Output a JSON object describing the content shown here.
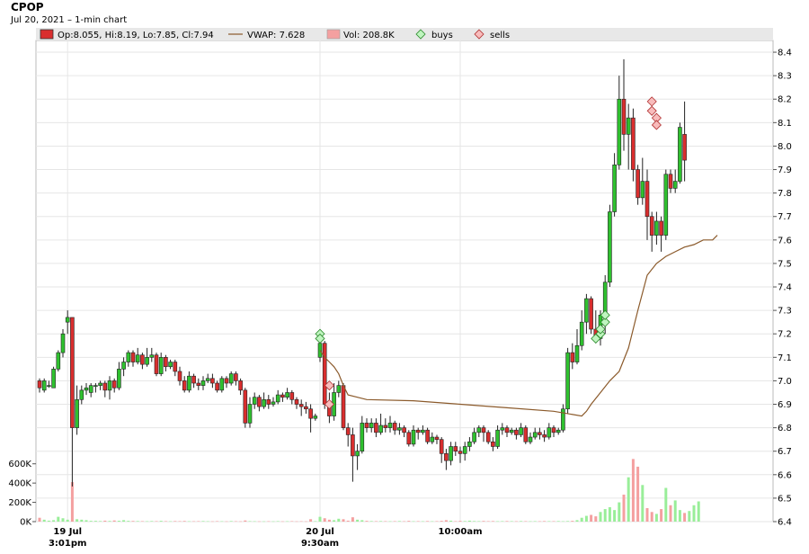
{
  "header": {
    "ticker": "CPOP",
    "subtitle": "Jul 20, 2021  – 1-min chart"
  },
  "legend": {
    "ohlc": "Op:8.055, Hi:8.19, Lo:7.85, Cl:7.94",
    "vwap": "VWAP: 7.628",
    "volume": "Vol: 208.8K",
    "buys": "buys",
    "sells": "sells"
  },
  "colors": {
    "up_candle": "#2fc12f",
    "down_candle": "#d92e2e",
    "up_volume": "#99ee99",
    "down_volume": "#f4a0a0",
    "vwap_line": "#8b5a2b",
    "buy_marker": "#bff5bf",
    "sell_marker": "#f8bcbc",
    "grid": "#e6e6e6",
    "legend_bg": "#e8e8e8"
  },
  "chart_data": {
    "type": "candlestick",
    "y_axis": {
      "min": 6.4,
      "max": 8.45,
      "ticks": [
        "6.4",
        "6.5",
        "6.6",
        "6.7",
        "6.8",
        "6.9",
        "7.0",
        "7.1",
        "7.2",
        "7.3",
        "7.4",
        "7.5",
        "7.6",
        "7.7",
        "7.8",
        "7.9",
        "8.0",
        "8.1",
        "8.2",
        "8.3",
        "8.4"
      ]
    },
    "volume_axis": {
      "min": 0,
      "max": 700000,
      "ticks": [
        {
          "v": 0,
          "label": "0K"
        },
        {
          "v": 200000,
          "label": "200K"
        },
        {
          "v": 400000,
          "label": "400K"
        },
        {
          "v": 600000,
          "label": "600K"
        }
      ]
    },
    "x_labels": [
      {
        "index": 6,
        "line1": "19 Jul",
        "line2": "3:01pm"
      },
      {
        "index": 60,
        "line1": "20 Jul",
        "line2": "9:30am"
      },
      {
        "index": 90,
        "line1": "10:00am",
        "line2": ""
      }
    ],
    "grid": true,
    "candles": [
      [
        7.0,
        6.97,
        7.01,
        6.95
      ],
      [
        6.96,
        7.0,
        7.01,
        6.95
      ],
      [
        6.98,
        6.98,
        7.0,
        6.97
      ],
      [
        6.97,
        7.05,
        7.06,
        6.97
      ],
      [
        7.05,
        7.12,
        7.13,
        7.04
      ],
      [
        7.12,
        7.2,
        7.22,
        7.1
      ],
      [
        7.25,
        7.27,
        7.3,
        7.2
      ],
      [
        7.27,
        6.8,
        7.27,
        6.55
      ],
      [
        6.8,
        6.92,
        6.98,
        6.77
      ],
      [
        6.92,
        6.96,
        6.98,
        6.9
      ],
      [
        6.96,
        6.97,
        6.99,
        6.94
      ],
      [
        6.95,
        6.98,
        6.99,
        6.93
      ],
      [
        6.98,
        6.98,
        6.99,
        6.95
      ],
      [
        6.98,
        6.99,
        7.0,
        6.96
      ],
      [
        6.99,
        6.96,
        7.0,
        6.93
      ],
      [
        6.96,
        7.0,
        7.02,
        6.92
      ],
      [
        7.0,
        6.97,
        7.01,
        6.95
      ],
      [
        6.97,
        7.05,
        7.08,
        6.96
      ],
      [
        7.05,
        7.08,
        7.1,
        7.02
      ],
      [
        7.08,
        7.12,
        7.13,
        7.06
      ],
      [
        7.12,
        7.08,
        7.13,
        7.06
      ],
      [
        7.08,
        7.11,
        7.14,
        7.07
      ],
      [
        7.11,
        7.07,
        7.12,
        7.05
      ],
      [
        7.07,
        7.1,
        7.14,
        7.06
      ],
      [
        7.1,
        7.11,
        7.14,
        7.08
      ],
      [
        7.11,
        7.03,
        7.12,
        7.02
      ],
      [
        7.03,
        7.1,
        7.12,
        7.02
      ],
      [
        7.1,
        7.06,
        7.11,
        7.04
      ],
      [
        7.06,
        7.08,
        7.09,
        7.05
      ],
      [
        7.08,
        7.04,
        7.09,
        7.02
      ],
      [
        7.04,
        7.0,
        7.06,
        6.98
      ],
      [
        7.0,
        6.96,
        7.02,
        6.95
      ],
      [
        6.96,
        7.02,
        7.04,
        6.95
      ],
      [
        7.02,
        6.99,
        7.03,
        6.97
      ],
      [
        6.99,
        6.98,
        7.01,
        6.96
      ],
      [
        6.98,
        7.0,
        7.02,
        6.96
      ],
      [
        7.0,
        7.01,
        7.03,
        6.99
      ],
      [
        7.01,
        6.99,
        7.03,
        6.97
      ],
      [
        6.99,
        6.96,
        7.0,
        6.95
      ],
      [
        6.96,
        7.01,
        7.02,
        6.95
      ],
      [
        7.01,
        6.99,
        7.02,
        6.97
      ],
      [
        6.99,
        7.03,
        7.04,
        6.98
      ],
      [
        7.03,
        7.0,
        7.04,
        6.98
      ],
      [
        7.0,
        6.96,
        7.01,
        6.94
      ],
      [
        6.96,
        6.82,
        6.97,
        6.8
      ],
      [
        6.82,
        6.9,
        6.93,
        6.8
      ],
      [
        6.9,
        6.93,
        6.95,
        6.88
      ],
      [
        6.93,
        6.89,
        6.94,
        6.87
      ],
      [
        6.89,
        6.92,
        6.95,
        6.88
      ],
      [
        6.92,
        6.9,
        6.94,
        6.88
      ],
      [
        6.9,
        6.91,
        6.93,
        6.89
      ],
      [
        6.91,
        6.94,
        6.96,
        6.9
      ],
      [
        6.94,
        6.93,
        6.95,
        6.91
      ],
      [
        6.93,
        6.95,
        6.97,
        6.92
      ],
      [
        6.95,
        6.92,
        6.96,
        6.9
      ],
      [
        6.92,
        6.9,
        6.93,
        6.88
      ],
      [
        6.9,
        6.89,
        6.92,
        6.85
      ],
      [
        6.89,
        6.88,
        6.91,
        6.86
      ],
      [
        6.88,
        6.84,
        6.9,
        6.78
      ],
      [
        6.84,
        6.85,
        6.86,
        6.83
      ],
      [
        7.1,
        7.16,
        7.18,
        7.08
      ],
      [
        7.16,
        6.9,
        7.17,
        6.88
      ],
      [
        6.9,
        6.85,
        6.95,
        6.82
      ],
      [
        6.85,
        6.95,
        6.99,
        6.83
      ],
      [
        6.95,
        6.98,
        7.0,
        6.93
      ],
      [
        6.98,
        6.8,
        6.99,
        6.79
      ],
      [
        6.8,
        6.77,
        6.82,
        6.72
      ],
      [
        6.77,
        6.68,
        6.8,
        6.57
      ],
      [
        6.68,
        6.7,
        6.73,
        6.62
      ],
      [
        6.7,
        6.82,
        6.85,
        6.69
      ],
      [
        6.82,
        6.8,
        6.84,
        6.78
      ],
      [
        6.8,
        6.82,
        6.84,
        6.78
      ],
      [
        6.82,
        6.78,
        6.84,
        6.76
      ],
      [
        6.78,
        6.81,
        6.86,
        6.77
      ],
      [
        6.81,
        6.8,
        6.84,
        6.78
      ],
      [
        6.8,
        6.82,
        6.85,
        6.78
      ],
      [
        6.82,
        6.79,
        6.83,
        6.77
      ],
      [
        6.79,
        6.8,
        6.82,
        6.77
      ],
      [
        6.8,
        6.78,
        6.81,
        6.76
      ],
      [
        6.78,
        6.73,
        6.79,
        6.72
      ],
      [
        6.73,
        6.79,
        6.81,
        6.72
      ],
      [
        6.79,
        6.78,
        6.8,
        6.75
      ],
      [
        6.78,
        6.79,
        6.81,
        6.77
      ],
      [
        6.79,
        6.74,
        6.8,
        6.73
      ],
      [
        6.74,
        6.76,
        6.78,
        6.73
      ],
      [
        6.76,
        6.75,
        6.77,
        6.73
      ],
      [
        6.75,
        6.69,
        6.76,
        6.65
      ],
      [
        6.69,
        6.66,
        6.71,
        6.62
      ],
      [
        6.66,
        6.72,
        6.74,
        6.64
      ],
      [
        6.72,
        6.7,
        6.74,
        6.68
      ],
      [
        6.7,
        6.69,
        6.72,
        6.65
      ],
      [
        6.69,
        6.72,
        6.74,
        6.66
      ],
      [
        6.72,
        6.74,
        6.76,
        6.7
      ],
      [
        6.74,
        6.78,
        6.8,
        6.73
      ],
      [
        6.78,
        6.8,
        6.81,
        6.76
      ],
      [
        6.8,
        6.78,
        6.81,
        6.74
      ],
      [
        6.78,
        6.74,
        6.79,
        6.73
      ],
      [
        6.74,
        6.72,
        6.76,
        6.7
      ],
      [
        6.72,
        6.79,
        6.81,
        6.71
      ],
      [
        6.79,
        6.8,
        6.82,
        6.77
      ],
      [
        6.8,
        6.78,
        6.81,
        6.76
      ],
      [
        6.78,
        6.79,
        6.8,
        6.77
      ],
      [
        6.79,
        6.77,
        6.8,
        6.75
      ],
      [
        6.77,
        6.8,
        6.82,
        6.76
      ],
      [
        6.8,
        6.74,
        6.81,
        6.73
      ],
      [
        6.74,
        6.76,
        6.78,
        6.73
      ],
      [
        6.76,
        6.78,
        6.8,
        6.75
      ],
      [
        6.78,
        6.77,
        6.8,
        6.75
      ],
      [
        6.77,
        6.76,
        6.79,
        6.74
      ],
      [
        6.76,
        6.8,
        6.82,
        6.75
      ],
      [
        6.8,
        6.78,
        6.81,
        6.76
      ],
      [
        6.78,
        6.79,
        6.8,
        6.77
      ],
      [
        6.79,
        6.88,
        6.9,
        6.78
      ],
      [
        6.88,
        7.12,
        7.14,
        6.86
      ],
      [
        7.12,
        7.08,
        7.16,
        7.05
      ],
      [
        7.08,
        7.15,
        7.22,
        7.07
      ],
      [
        7.15,
        7.25,
        7.3,
        7.13
      ],
      [
        7.25,
        7.35,
        7.37,
        7.2
      ],
      [
        7.35,
        7.22,
        7.36,
        7.2
      ],
      [
        7.22,
        7.18,
        7.3,
        7.16
      ],
      [
        7.18,
        7.28,
        7.3,
        7.15
      ],
      [
        7.28,
        7.42,
        7.45,
        7.2
      ],
      [
        7.42,
        7.72,
        7.75,
        7.4
      ],
      [
        7.72,
        7.92,
        7.97,
        7.7
      ],
      [
        7.92,
        8.2,
        8.3,
        7.9
      ],
      [
        8.2,
        8.05,
        8.37,
        7.98
      ],
      [
        8.05,
        8.12,
        8.18,
        7.9
      ],
      [
        8.12,
        7.9,
        8.16,
        7.85
      ],
      [
        7.9,
        7.78,
        7.92,
        7.75
      ],
      [
        7.78,
        7.85,
        7.95,
        7.75
      ],
      [
        7.85,
        7.7,
        7.9,
        7.6
      ],
      [
        7.7,
        7.62,
        7.72,
        7.55
      ],
      [
        7.62,
        7.68,
        7.72,
        7.58
      ],
      [
        7.68,
        7.62,
        7.7,
        7.55
      ],
      [
        7.62,
        7.88,
        7.9,
        7.6
      ],
      [
        7.88,
        7.82,
        7.9,
        7.8
      ],
      [
        7.82,
        7.85,
        7.9,
        7.8
      ],
      [
        7.85,
        8.08,
        8.1,
        7.84
      ],
      [
        8.05,
        7.94,
        8.19,
        7.85
      ]
    ],
    "volume": [
      40000,
      20000,
      10000,
      15000,
      50000,
      35000,
      20000,
      410000,
      25000,
      20000,
      15000,
      8000,
      8000,
      6000,
      10000,
      7000,
      12000,
      9000,
      15000,
      8000,
      7000,
      6000,
      5000,
      4000,
      6000,
      5000,
      8000,
      5000,
      4000,
      6000,
      5000,
      7000,
      4000,
      4000,
      5000,
      6000,
      4000,
      3000,
      5000,
      4000,
      3000,
      6000,
      4000,
      3000,
      12000,
      5000,
      4000,
      3000,
      3000,
      4000,
      3000,
      5000,
      3000,
      4000,
      5000,
      3000,
      4000,
      3000,
      25000,
      5000,
      50000,
      35000,
      20000,
      15000,
      30000,
      25000,
      10000,
      45000,
      20000,
      15000,
      8000,
      6000,
      5000,
      6000,
      5000,
      4000,
      5000,
      6000,
      4000,
      8000,
      4000,
      5000,
      4000,
      6000,
      4000,
      5000,
      8000,
      15000,
      10000,
      5000,
      8000,
      6000,
      10000,
      6000,
      5000,
      7000,
      5000,
      6000,
      4000,
      5000,
      6000,
      5000,
      4000,
      6000,
      5000,
      4000,
      5000,
      4000,
      6000,
      5000,
      5000,
      6000,
      4000,
      6000,
      8000,
      15000,
      40000,
      60000,
      70000,
      55000,
      100000,
      130000,
      150000,
      120000,
      200000,
      280000,
      460000,
      650000,
      570000,
      380000,
      140000,
      100000,
      80000,
      130000,
      350000,
      170000,
      220000,
      120000,
      90000,
      110000,
      170000,
      210000
    ],
    "vwap": [
      [
        60,
        7.13
      ],
      [
        61,
        7.1
      ],
      [
        62,
        7.08
      ],
      [
        63,
        7.06
      ],
      [
        64,
        7.03
      ],
      [
        65,
        6.98
      ],
      [
        66,
        6.94
      ],
      [
        68,
        6.93
      ],
      [
        70,
        6.92
      ],
      [
        80,
        6.915
      ],
      [
        90,
        6.9
      ],
      [
        100,
        6.885
      ],
      [
        110,
        6.87
      ],
      [
        116,
        6.85
      ],
      [
        117,
        6.87
      ],
      [
        118,
        6.9
      ],
      [
        120,
        6.95
      ],
      [
        122,
        7.0
      ],
      [
        124,
        7.04
      ],
      [
        126,
        7.14
      ],
      [
        128,
        7.3
      ],
      [
        130,
        7.45
      ],
      [
        132,
        7.5
      ],
      [
        134,
        7.53
      ],
      [
        136,
        7.55
      ],
      [
        138,
        7.57
      ],
      [
        140,
        7.58
      ],
      [
        142,
        7.6
      ],
      [
        144,
        7.6
      ],
      [
        145,
        7.62
      ]
    ],
    "buys": [
      [
        60,
        7.2
      ],
      [
        60,
        7.18
      ],
      [
        119,
        7.18
      ],
      [
        120,
        7.2
      ],
      [
        120,
        7.22
      ],
      [
        121,
        7.25
      ],
      [
        121,
        7.28
      ]
    ],
    "sells": [
      [
        62,
        6.98
      ],
      [
        62,
        6.9
      ],
      [
        131,
        8.19
      ],
      [
        131,
        8.15
      ],
      [
        132,
        8.12
      ],
      [
        132,
        8.09
      ]
    ]
  }
}
